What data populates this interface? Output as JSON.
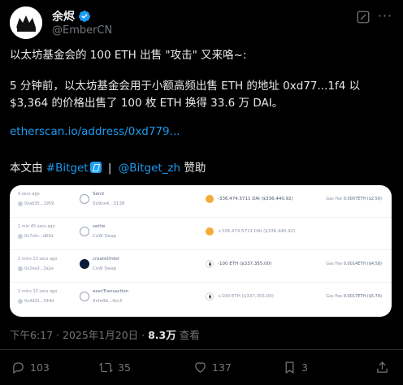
{
  "author": {
    "name": "余烬",
    "handle": "@EmberCN"
  },
  "tweet": {
    "line1": "以太坊基金会的 100 ETH 出售 \"攻击\" 又来咯~:",
    "line2": "5 分钟前，以太坊基金会用于小额高频出售 ETH 的地址 0xd77...1f4 以 $3,364 的价格出售了 100 枚 ETH 换得 33.6 万 DAI。",
    "link": "etherscan.io/address/0xd779...",
    "sponsor_prefix": "本文由",
    "sponsor_tag": "#Bitget",
    "sponsor_sep": "|",
    "sponsor_mention": "@Bitget_zh",
    "sponsor_suffix": "赞助"
  },
  "transactions": [
    {
      "time": "9 secs ago",
      "from": "0xab35...1959",
      "method": "Send",
      "sub": "0x9ce4...3138",
      "amount": "-336,474.5711 DAI ($336,440.92)",
      "amount_sign": "neg",
      "coin": "dai",
      "gas_label": "Gas Fee",
      "gas_value": "0.0007ETH ($2.50)"
    },
    {
      "time": "1 min 45 secs ago",
      "from": "0x7cbc...d83d",
      "method": "settle",
      "sub": "CoW Swap",
      "amount": "+336,474.5711 DAI ($336,440.92)",
      "amount_sign": "pos",
      "coin": "dai",
      "gas_label": "",
      "gas_value": ""
    },
    {
      "time": "2 mins 23 secs ago",
      "from": "0x2ea3...3a2e",
      "method": "createOrder",
      "sub": "CoW Swap",
      "amount": "-100 ETH ($337,355.00)",
      "amount_sign": "neg",
      "coin": "eth",
      "gas_label": "Gas Fee",
      "gas_value": "0.0014ETH ($4.58)"
    },
    {
      "time": "2 mins 33 secs ago",
      "from": "0x4d31...544d",
      "method": "execTransaction",
      "sub": "0xfe9b...fbc3",
      "amount": "+100 ETH ($337,355.00)",
      "amount_sign": "pos",
      "coin": "eth",
      "gas_label": "Gas Fee",
      "gas_value": "0.0017ETH ($5.74)"
    }
  ],
  "meta": {
    "time": "下午6:17 · 2025年1月20日 · ",
    "views": "8.3万",
    "views_label": " 查看"
  },
  "stats": {
    "replies": "103",
    "retweets": "35",
    "likes": "137",
    "bookmarks": "3"
  },
  "colors": {
    "background": "#000000",
    "text": "#e7e9ea",
    "secondary": "#71767b",
    "link": "#1d9bf0",
    "verified": "#1d9bf0"
  },
  "icons": [
    "verified-icon",
    "grok-icon",
    "more-icon",
    "reply-icon",
    "retweet-icon",
    "like-icon",
    "views-icon",
    "bookmark-icon",
    "share-icon"
  ]
}
